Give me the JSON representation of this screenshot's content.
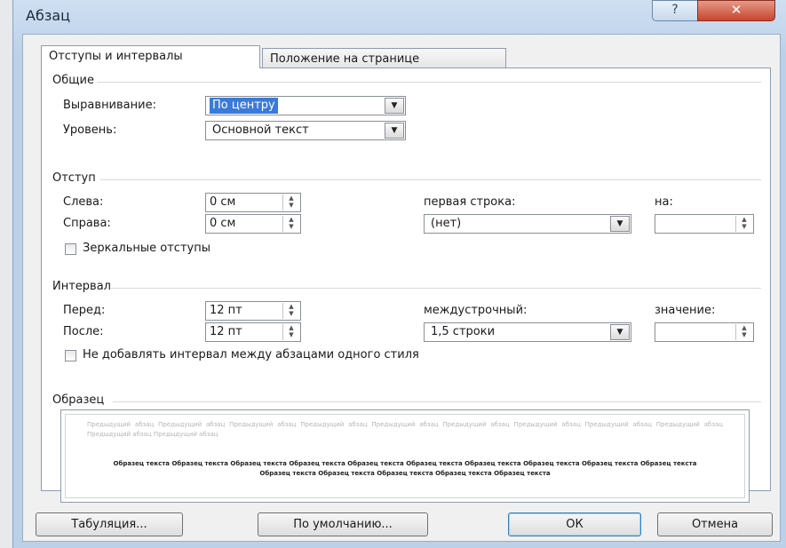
{
  "dialog": {
    "title": "Абзац",
    "help_label": "?",
    "close_label": "✕"
  },
  "tabs": [
    {
      "label": "Отступы и интервалы"
    },
    {
      "label": "Положение на странице"
    }
  ],
  "general": {
    "title": "Общие",
    "alignment_label": "Выравнивание:",
    "alignment_value": "По центру",
    "level_label": "Уровень:",
    "level_value": "Основной текст"
  },
  "indent": {
    "title": "Отступ",
    "left_label": "Слева:",
    "left_value": "0 см",
    "right_label": "Справа:",
    "right_value": "0 см",
    "first_line_label": "первая строка:",
    "first_line_value": "(нет)",
    "by_label": "на:",
    "by_value": "",
    "mirror_label": "Зеркальные отступы"
  },
  "spacing": {
    "title": "Интервал",
    "before_label": "Перед:",
    "before_value": "12 пт",
    "after_label": "После:",
    "after_value": "12 пт",
    "line_label": "междустрочный:",
    "line_value": "1,5 строки",
    "at_label": "значение:",
    "at_value": "",
    "no_space_label": "Не добавлять интервал между абзацами одного стиля"
  },
  "preview": {
    "title": "Образец",
    "prev_text": "Предыдущий абзац Предыдущий абзац Предыдущий абзац Предыдущий абзац Предыдущий абзац Предыдущий абзац Предыдущий абзац Предыдущий абзац Предыдущий абзац Предыдущий абзац Предыдущий абзац",
    "sample_text": "Образец текста Образец текста Образец текста Образец текста Образец текста Образец текста Образец текста Образец текста Образец текста Образец текста Образец текста Образец текста Образец текста Образец текста Образец текста"
  },
  "buttons": {
    "tabs_label": "Табуляция...",
    "default_label": "По умолчанию...",
    "ok_label": "ОК",
    "cancel_label": "Отмена"
  },
  "icons": {
    "dropdown": "▼",
    "spin_up": "▲",
    "spin_down": "▼"
  }
}
